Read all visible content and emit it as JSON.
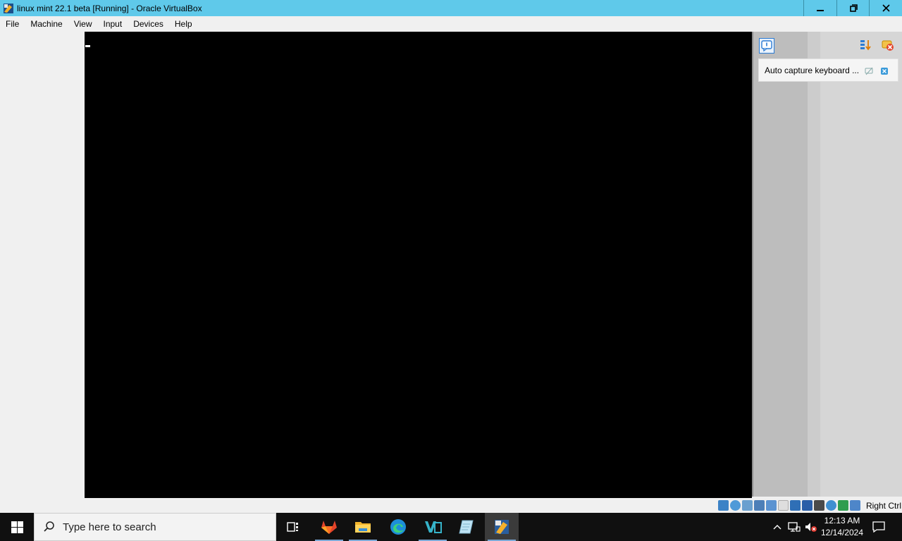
{
  "window": {
    "title": "linux mint 22.1 beta [Running] - Oracle VirtualBox",
    "controls": {
      "minimize": "minimize-icon",
      "restore": "restore-icon",
      "close": "close-icon"
    }
  },
  "menubar": {
    "items": [
      {
        "label": "File"
      },
      {
        "label": "Machine"
      },
      {
        "label": "View"
      },
      {
        "label": "Input"
      },
      {
        "label": "Devices"
      },
      {
        "label": "Help"
      }
    ]
  },
  "notifications": {
    "message": "Auto capture keyboard ...",
    "accent": "#2a7bd4"
  },
  "statusbar": {
    "icons": [
      "hard-disk-icon",
      "optical-drive-icon",
      "audio-icon",
      "network-icon",
      "usb-icon",
      "shared-folders-icon",
      "display-icon",
      "video-capture-icon",
      "guest-additions-icon",
      "cpu-icon",
      "mouse-integration-icon",
      "keyboard-capture-icon"
    ],
    "host_key": "Right Ctrl"
  },
  "taskbar": {
    "search_placeholder": "Type here to search",
    "apps": [
      "task-view-icon",
      "gitlab-icon",
      "file-explorer-icon",
      "edge-icon",
      "visual-studio-icon",
      "notepad-icon",
      "virtualbox-icon"
    ],
    "tray": {
      "time": "12:13 AM",
      "date": "12/14/2024"
    }
  }
}
